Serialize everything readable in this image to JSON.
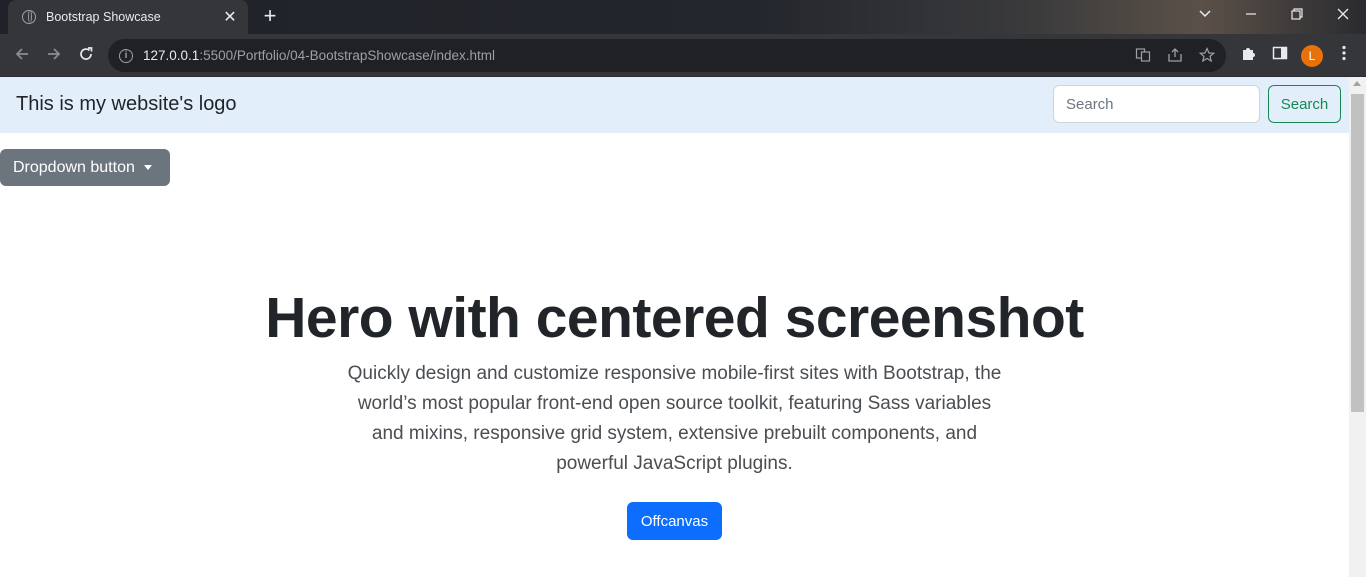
{
  "browser": {
    "tab_title": "Bootstrap Showcase",
    "tab_close": "✕",
    "new_tab": "+",
    "url_host": "127.0.0.1",
    "url_rest": ":5500/Portfolio/04-BootstrapShowcase/index.html",
    "profile_initial": "L",
    "icons": {
      "back": "back-arrow-icon",
      "forward": "forward-arrow-icon",
      "reload": "reload-icon",
      "info": "info-icon",
      "translate": "translate-icon",
      "share": "share-icon",
      "bookmark": "star-icon",
      "extensions": "puzzle-icon",
      "side_panel": "side-panel-icon",
      "menu": "kebab-menu-icon",
      "tab_search": "chevron-down-icon",
      "minimize": "minimize-icon",
      "restore": "restore-icon",
      "close": "close-icon"
    }
  },
  "navbar": {
    "brand": "This is my website's logo",
    "search_placeholder": "Search",
    "search_button": "Search"
  },
  "dropdown": {
    "label": "Dropdown button"
  },
  "hero": {
    "title": "Hero with centered screenshot",
    "lead": "Quickly design and customize responsive mobile-first sites with Bootstrap, the world’s most popular front-end open source toolkit, featuring Sass variables and mixins, responsive grid system, extensive prebuilt components, and powerful JavaScript plugins.",
    "button": "Offcanvas"
  },
  "colors": {
    "navbar_bg": "#e2effb",
    "success": "#198754",
    "secondary": "#6c757d",
    "primary": "#0d6efd",
    "avatar": "#e8710a"
  }
}
